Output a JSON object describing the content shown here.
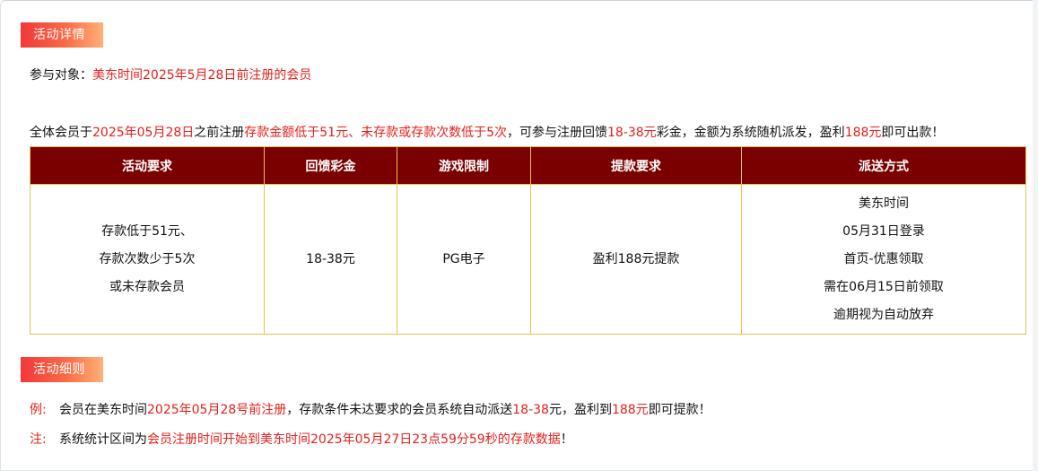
{
  "details": {
    "tag": "活动详情",
    "target_label": "参与对象：",
    "target_value": "美东时间2025年5月28日前注册的会员",
    "summary": {
      "p1": "全体会员于",
      "date": "2025年05月28日",
      "p2": "之前注册",
      "cond": "存款金额低于51元、未存款或存款次数低于5次",
      "p3": "，可参与注册回馈",
      "range": "18-38元",
      "p4": "彩金，金额为系统随机派发，盈利",
      "profit": "188元",
      "p5": "即可出款！"
    }
  },
  "table": {
    "headers": [
      "活动要求",
      "回馈彩金",
      "游戏限制",
      "提款要求",
      "派送方式"
    ],
    "requirement_lines": [
      "存款低于51元、",
      "存款次数少于5次",
      "或未存款会员"
    ],
    "bonus": "18-38元",
    "game": "PG电子",
    "withdraw": "盈利188元提款",
    "delivery_lines": [
      "美东时间",
      "05月31日登录",
      "首页-优惠领取",
      "需在06月15日前领取",
      "逾期视为自动放弃"
    ]
  },
  "rules": {
    "tag": "活动细则",
    "example": {
      "label": "例:",
      "t1": "会员在美东时间",
      "date": "2025年05月28号前注册",
      "t2": "，存款条件未达要求的会员系统自动派送",
      "range": "18-38",
      "t3": "元，盈利到",
      "profit": "188元",
      "t4": "即可提款！"
    },
    "note": {
      "label": "注:",
      "t1": "系统统计区间为",
      "period": "会员注册时间开始到美东时间2025年05月27日23点59分59秒的存款数据",
      "t2": "！"
    }
  }
}
